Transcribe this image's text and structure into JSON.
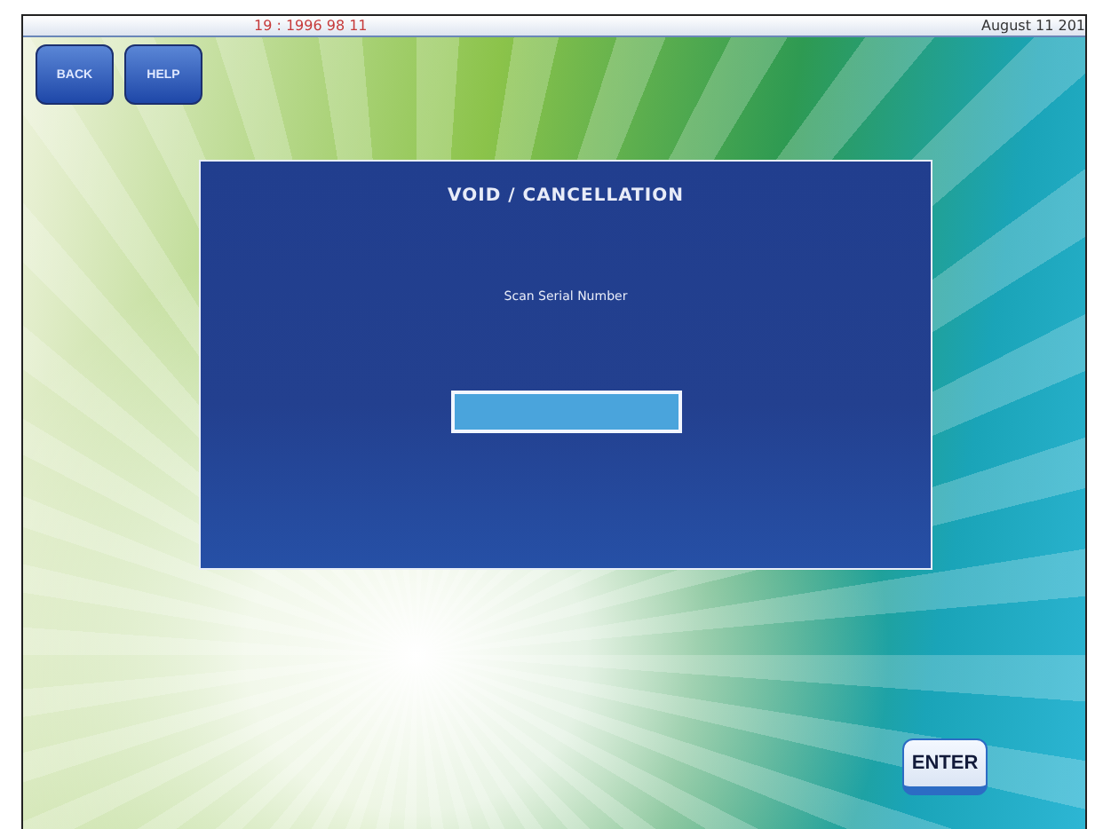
{
  "status_bar": {
    "code": "19 : 1996 98 11",
    "date": "August 11 201"
  },
  "buttons": [
    "BACK",
    "HELP"
  ],
  "dialog": {
    "title": "VOID / CANCELLATION",
    "prompt": "Scan Serial Number"
  },
  "enter_button": "ENTER"
}
